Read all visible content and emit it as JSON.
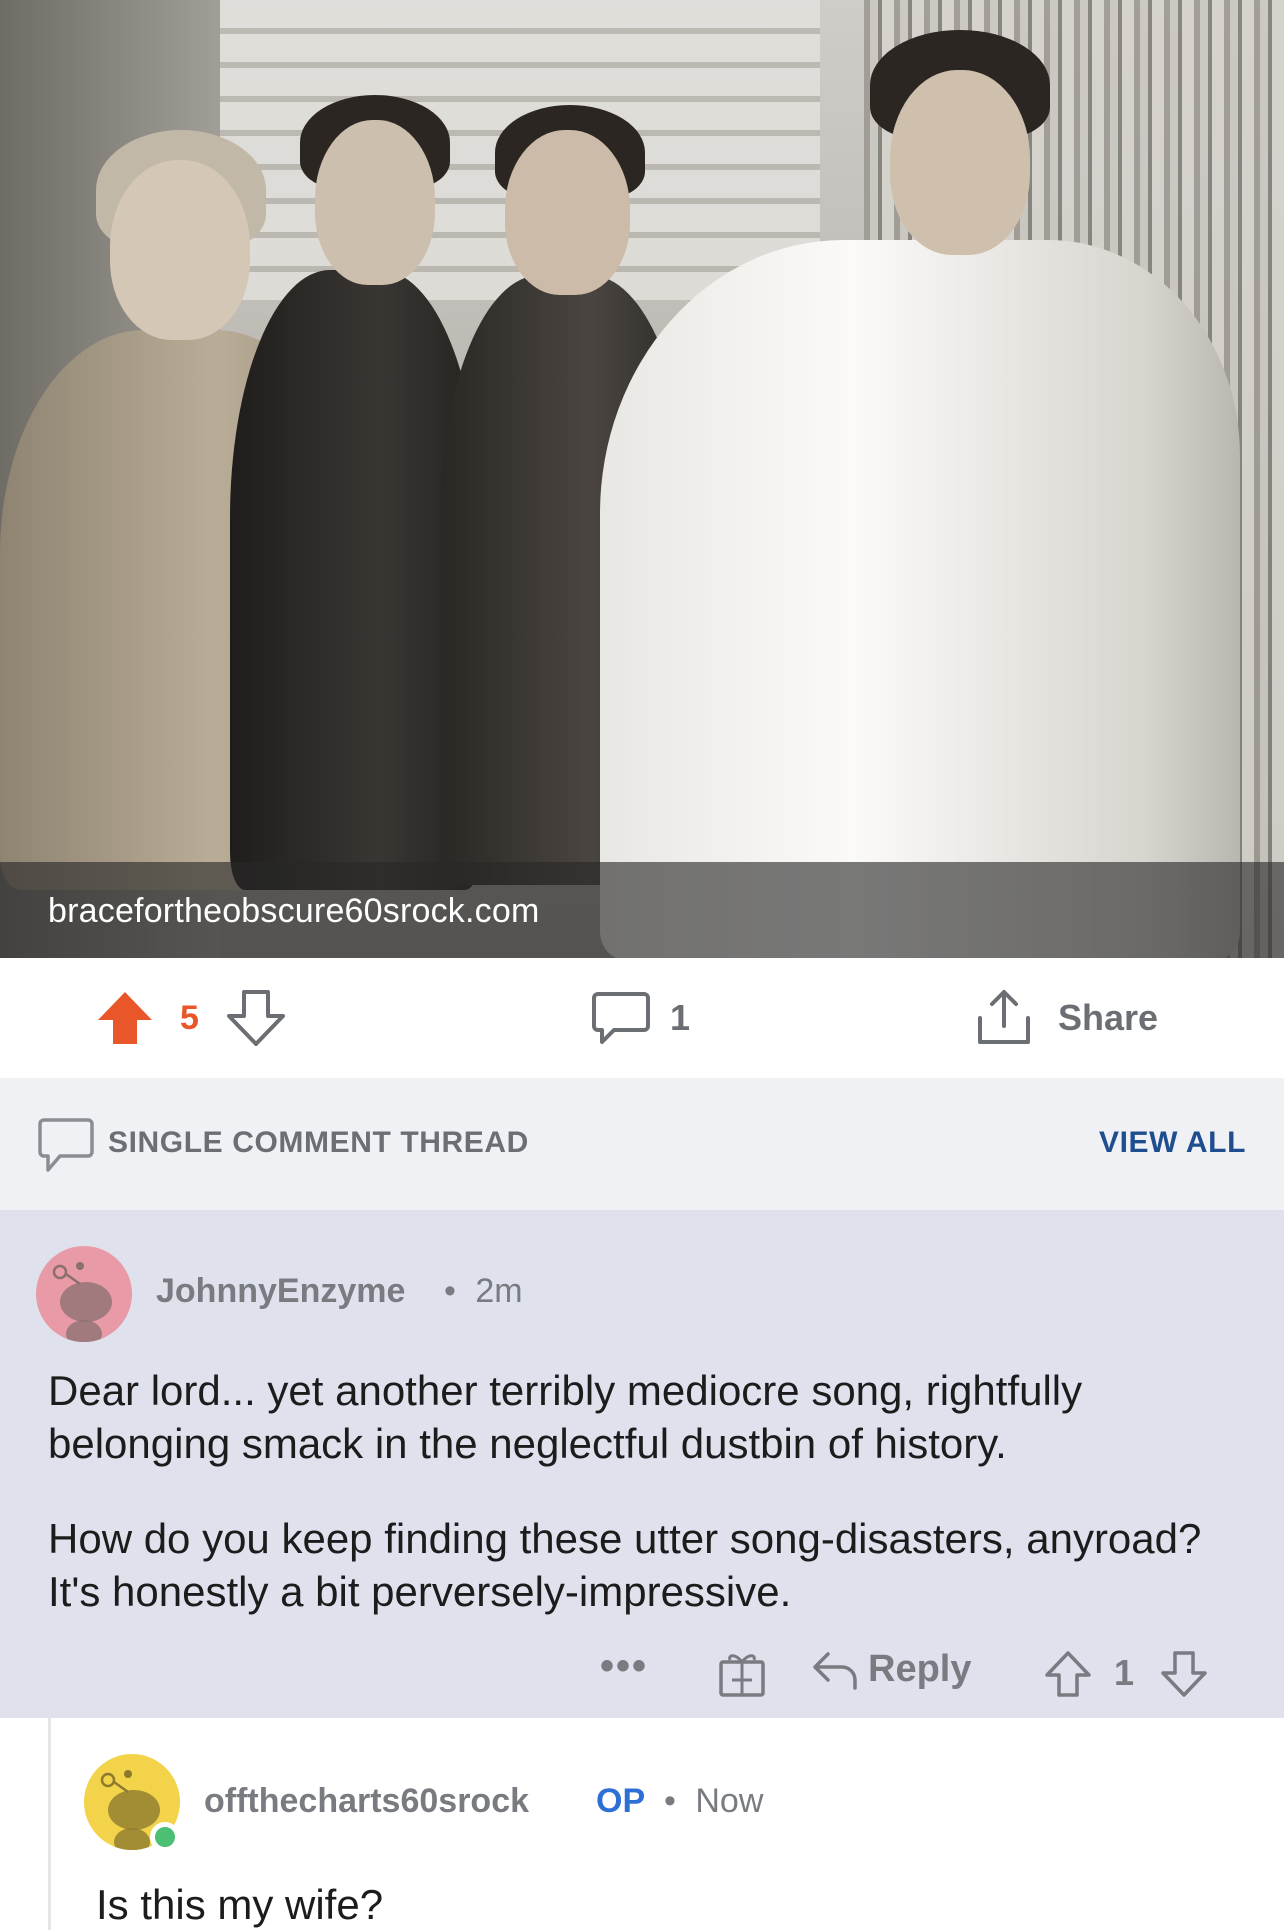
{
  "post": {
    "link_domain": "bracefortheobscure60srock.com",
    "score": "5",
    "comment_count": "1",
    "share_label": "Share"
  },
  "thread_header": {
    "title": "SINGLE COMMENT THREAD",
    "view_all": "VIEW ALL"
  },
  "comments": [
    {
      "username": "JohnnyEnzyme",
      "separator": "•",
      "time": "2m",
      "paragraphs": [
        "Dear lord... yet another terribly mediocre song, rightfully belonging smack in the neglectful dustbin of history.",
        "How do you keep finding these utter song-disasters, anyroad?  It's honestly a bit perversely-impressive."
      ],
      "more_label": "•••",
      "reply_label": "Reply",
      "score": "1"
    },
    {
      "username": "offthecharts60srock",
      "badge": "OP",
      "separator": "•",
      "time": "Now",
      "paragraphs": [
        "Is this my wife?"
      ]
    }
  ],
  "colors": {
    "upvote_active": "#e8562a",
    "link_blue": "#1f4e8f",
    "op_blue": "#2e6fd6",
    "highlight_bg": "#dfe2ed",
    "online": "#4bbf73"
  },
  "icons": [
    "upvote-icon",
    "downvote-icon",
    "comment-icon",
    "share-icon",
    "gift-icon",
    "reply-icon"
  ]
}
